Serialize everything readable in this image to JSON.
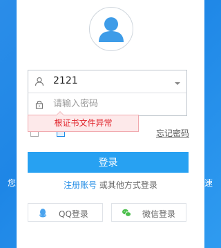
{
  "background": {
    "left_text": "您",
    "right_text": "速"
  },
  "login": {
    "username": "2121",
    "password_placeholder": "请输入密码",
    "error_message": "根证书文件异常",
    "remember_label": "",
    "auto_login_label": "",
    "forgot_label": "忘记密码",
    "login_button": "登录",
    "register_link": "注册账号",
    "other_login_text": " 或其他方式登录",
    "qq_button": "QQ登录",
    "wechat_button": "微信登录"
  },
  "colors": {
    "accent": "#27a1f2",
    "link": "#1e8ae5",
    "error": "#e0232b",
    "background": "#1e86e6"
  },
  "icons": {
    "avatar": "user-avatar-icon",
    "user": "user-icon",
    "lock": "lock-icon",
    "dropdown": "dropdown-arrow-icon",
    "qq": "qq-icon",
    "wechat": "wechat-icon"
  }
}
